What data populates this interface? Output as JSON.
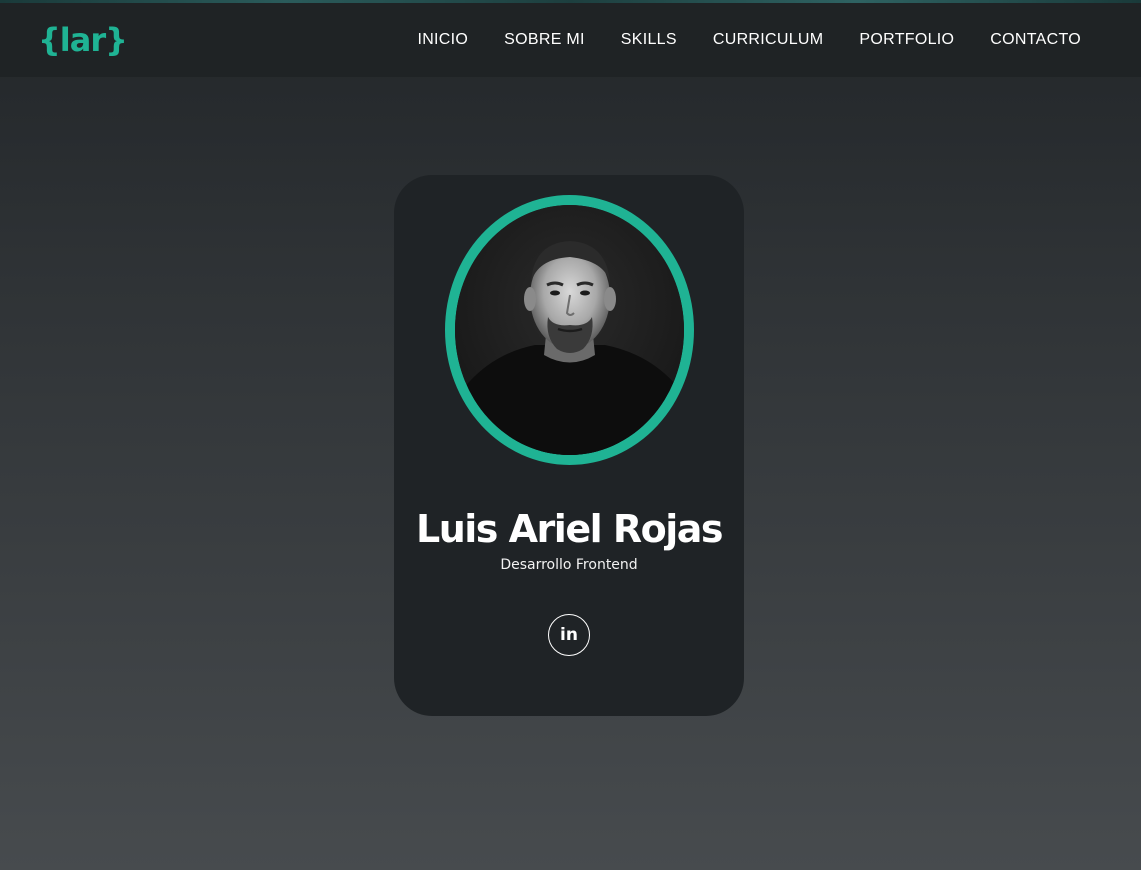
{
  "brand": {
    "logo_text": "{lar}",
    "accent_color": "#1fb394"
  },
  "nav": {
    "items": [
      {
        "label": "INICIO"
      },
      {
        "label": "SOBRE MI"
      },
      {
        "label": "SKILLS"
      },
      {
        "label": "CURRICULUM"
      },
      {
        "label": "PORTFOLIO"
      },
      {
        "label": "CONTACTO"
      }
    ]
  },
  "profile": {
    "name": "Luis Ariel Rojas",
    "role": "Desarrollo Frontend",
    "photo_icon": "profile-photo",
    "social": [
      {
        "icon": "linkedin-icon",
        "glyph": "in"
      }
    ]
  }
}
